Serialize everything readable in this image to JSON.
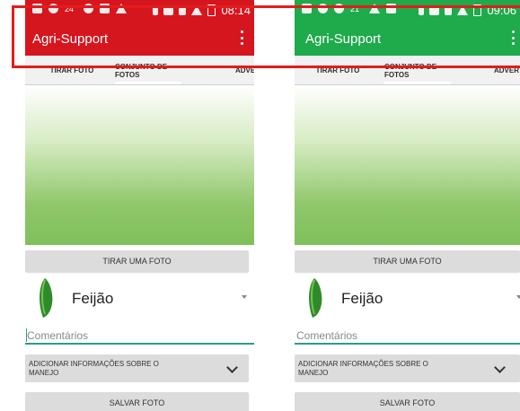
{
  "screens": [
    {
      "theme_color": "#d6161f",
      "status": {
        "temp": "24°",
        "time": "08:14"
      },
      "app_title": "Agri-Support",
      "tabs": [
        "TIRAR FOTO",
        "CONJUNTO DE FOTOS",
        "ADVER"
      ],
      "take_photo_button": "TIRAR UMA FOTO",
      "crop": "Feijão",
      "comments_placeholder": "Comentários",
      "manejo_label": "ADICIONAR INFORMAÇÕES SOBRE O MANEJO",
      "save_button": "SALVAR FOTO"
    },
    {
      "theme_color": "#1faa4c",
      "status": {
        "temp": "21°",
        "time": "09:06"
      },
      "app_title": "Agri-Support",
      "tabs": [
        "TIRAR FOTO",
        "CONJUNTO DE FOTOS",
        "ADVER"
      ],
      "take_photo_button": "TIRAR UMA FOTO",
      "crop": "Feijão",
      "comments_placeholder": "Comentários",
      "manejo_label": "ADICIONAR INFORMAÇÕES SOBRE O MANEJO",
      "save_button": "SALVAR FOTO"
    }
  ],
  "icons": {
    "status_left": [
      "back-icon",
      "usb-icon",
      "alarm-icon",
      "image-icon",
      "weather-icon"
    ],
    "status_right": [
      "bluetooth-icon",
      "nfc-icon",
      "4g-icon",
      "signal-icon",
      "battery-icon"
    ],
    "overflow": "overflow-menu-icon",
    "crop": "green-bean-icon",
    "expand": "chevron-down-icon"
  },
  "highlight_color": "#e21c1c"
}
